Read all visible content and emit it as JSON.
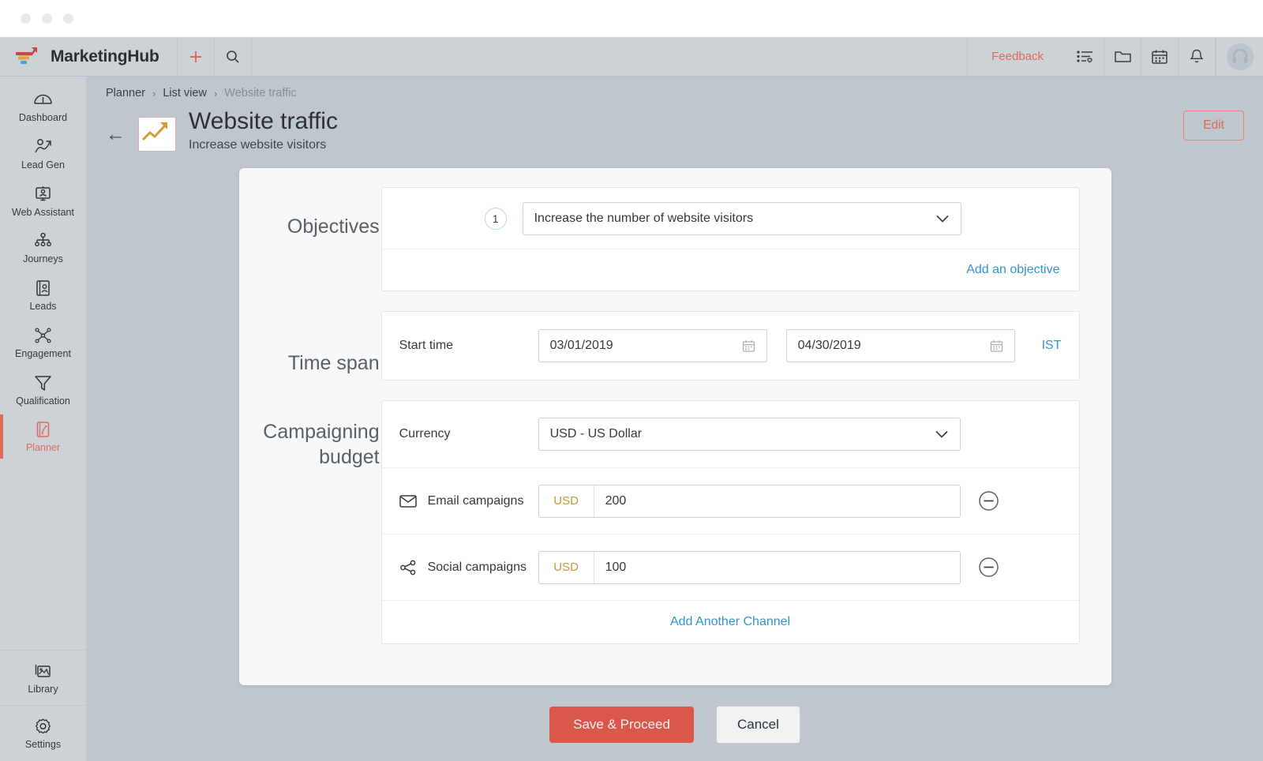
{
  "window": {
    "dots": [
      "close",
      "minimize",
      "maximize"
    ]
  },
  "header": {
    "brand": "MarketingHub",
    "add_label": "+",
    "search_icon": "search-icon",
    "feedback": "Feedback",
    "icons": [
      "list-heart-icon",
      "folder-icon",
      "calendar-icon",
      "bell-icon"
    ],
    "avatar": "user-avatar"
  },
  "sidebar": {
    "items": [
      {
        "label": "Dashboard",
        "icon": "gauge-icon",
        "active": false
      },
      {
        "label": "Lead Gen",
        "icon": "lead-gen-icon",
        "active": false
      },
      {
        "label": "Web Assistant",
        "icon": "web-assistant-icon",
        "active": false
      },
      {
        "label": "Journeys",
        "icon": "journeys-icon",
        "active": false
      },
      {
        "label": "Leads",
        "icon": "leads-icon",
        "active": false
      },
      {
        "label": "Engagement",
        "icon": "engagement-icon",
        "active": false
      },
      {
        "label": "Qualification",
        "icon": "funnel-icon",
        "active": false
      },
      {
        "label": "Planner",
        "icon": "planner-icon",
        "active": true
      }
    ],
    "bottom_items": [
      {
        "label": "Library",
        "icon": "library-icon"
      },
      {
        "label": "Settings",
        "icon": "gear-icon"
      }
    ]
  },
  "breadcrumb": {
    "root": "Planner",
    "middle": "List view",
    "current": "Website traffic",
    "separator": "›"
  },
  "page": {
    "title": "Website traffic",
    "subtitle": "Increase website visitors",
    "back_arrow": "←",
    "edit_label": "Edit"
  },
  "form": {
    "objectives": {
      "section_label": "Objectives",
      "rows": [
        {
          "number": "1",
          "value": "Increase the number of website visitors"
        }
      ],
      "add_link": "Add an objective"
    },
    "timespan": {
      "section_label": "Time span",
      "field_label": "Start time",
      "start_date": "03/01/2019",
      "end_date": "04/30/2019",
      "timezone": "IST"
    },
    "budget": {
      "section_label_line1": "Campaigning",
      "section_label_line2": "budget",
      "currency_label": "Currency",
      "currency_value": "USD - US Dollar",
      "channels": [
        {
          "label": "Email campaigns",
          "icon": "envelope-icon",
          "currency": "USD",
          "amount": "200"
        },
        {
          "label": "Social campaigns",
          "icon": "share-icon",
          "currency": "USD",
          "amount": "100"
        }
      ],
      "add_link": "Add Another Channel"
    }
  },
  "footer": {
    "primary": "Save & Proceed",
    "secondary": "Cancel"
  },
  "colors": {
    "accent_red": "#d9574b",
    "link_blue": "#2f95d5",
    "currency_gold": "#c39a34",
    "backdrop": "#bfc6cd",
    "sidebar": "#cdd2d7"
  }
}
